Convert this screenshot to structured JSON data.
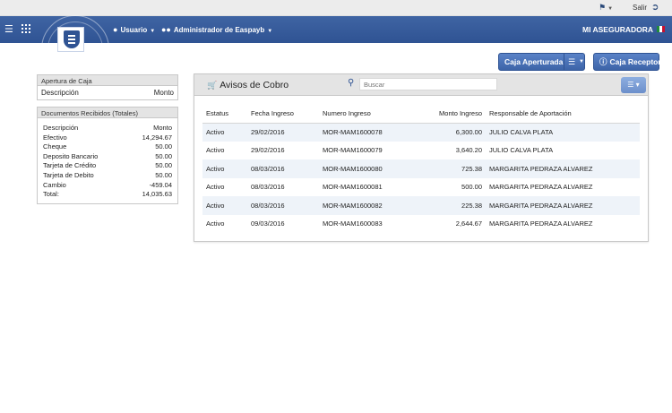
{
  "topbar": {
    "exit_label": "Salir"
  },
  "navbar": {
    "usuario_label": "Usuario",
    "admin_label": "Administrador de Easpayb",
    "brand": "MI ASEGURADORA"
  },
  "actions": {
    "caja_aperturada": "Caja Aperturada",
    "caja_receptora": "Caja Receptora"
  },
  "apertura": {
    "title": "Apertura de Caja",
    "col_desc": "Descripción",
    "col_monto": "Monto"
  },
  "docs": {
    "title": "Documentos Recibidos (Totales)",
    "rows": [
      {
        "k": "Descripción",
        "v": "Monto"
      },
      {
        "k": "Efectivo",
        "v": "14,294.67"
      },
      {
        "k": "Cheque",
        "v": "50.00"
      },
      {
        "k": "Deposito Bancario",
        "v": "50.00"
      },
      {
        "k": "Tarjeta de Crédito",
        "v": "50.00"
      },
      {
        "k": "Tarjeta de Debito",
        "v": "50.00"
      },
      {
        "k": "Cambio",
        "v": "-459.04"
      },
      {
        "k": "Total:",
        "v": "14,035.63"
      }
    ]
  },
  "avisos": {
    "title": "Avisos de Cobro",
    "search_placeholder": "Buscar",
    "columns": [
      "Estatus",
      "Fecha Ingreso",
      "Numero Ingreso",
      "Monto Ingreso",
      "Responsable de Aportación"
    ],
    "rows": [
      [
        "Activo",
        "29/02/2016",
        "MOR-MAM1600078",
        "6,300.00",
        "JULIO CALVA PLATA"
      ],
      [
        "Activo",
        "29/02/2016",
        "MOR-MAM1600079",
        "3,640.20",
        "JULIO CALVA PLATA"
      ],
      [
        "Activo",
        "08/03/2016",
        "MOR-MAM1600080",
        "725.38",
        "MARGARITA PEDRAZA ALVAREZ"
      ],
      [
        "Activo",
        "08/03/2016",
        "MOR-MAM1600081",
        "500.00",
        "MARGARITA PEDRAZA ALVAREZ"
      ],
      [
        "Activo",
        "08/03/2016",
        "MOR-MAM1600082",
        "225.38",
        "MARGARITA PEDRAZA ALVAREZ"
      ],
      [
        "Activo",
        "09/03/2016",
        "MOR-MAM1600083",
        "2,644.67",
        "MARGARITA PEDRAZA ALVAREZ"
      ]
    ]
  },
  "icons": {
    "top_menu": "flag-menu-icon",
    "exit": "exit-icon",
    "hamburger": "menu-icon",
    "apps": "grid-icon",
    "user": "user-icon",
    "users": "users-icon",
    "cart": "cart-icon",
    "search": "search-icon",
    "info": "info-icon"
  },
  "colors": {
    "navbar": "#2f5393",
    "button": "#4a72b8",
    "row_alt": "#eef3f9"
  }
}
